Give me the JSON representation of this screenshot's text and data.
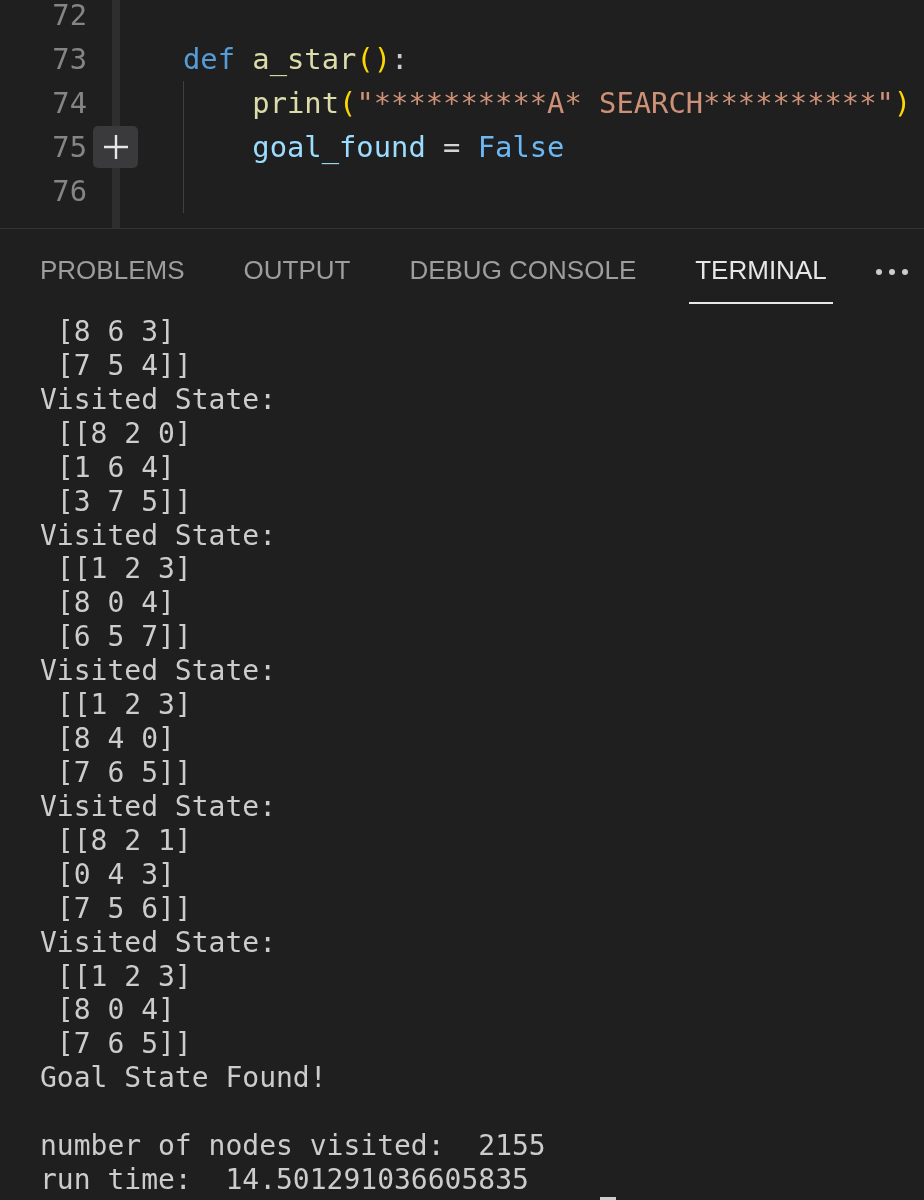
{
  "editor": {
    "lines": [
      {
        "number": "72",
        "add_button": false
      },
      {
        "number": "73",
        "add_button": false,
        "tokens": [
          {
            "kind": "keyword",
            "text": "def "
          },
          {
            "kind": "function",
            "text": "a_star"
          },
          {
            "kind": "bracket",
            "text": "()"
          },
          {
            "kind": "punctuation",
            "text": ":"
          }
        ],
        "children": [
          {
            "number": "74",
            "add_button": false,
            "tokens": [
              {
                "kind": "function",
                "text": "print"
              },
              {
                "kind": "bracket",
                "text": "("
              },
              {
                "kind": "string",
                "text": "\"**********A* SEARCH**********\""
              },
              {
                "kind": "bracket",
                "text": ")"
              }
            ]
          },
          {
            "number": "75",
            "add_button": true,
            "tokens": [
              {
                "kind": "variable",
                "text": "goal_found"
              },
              {
                "kind": "operator",
                "text": " = "
              },
              {
                "kind": "constant",
                "text": "False"
              }
            ]
          },
          {
            "number": "76",
            "add_button": false
          }
        ]
      }
    ]
  },
  "panel": {
    "tabs": [
      {
        "label": "PROBLEMS",
        "selected": false
      },
      {
        "label": "OUTPUT",
        "selected": false
      },
      {
        "label": "DEBUG CONSOLE",
        "selected": false
      },
      {
        "label": "TERMINAL",
        "selected": true
      }
    ],
    "terminal": {
      "lines": [
        " [8 6 3]",
        " [7 5 4]]",
        "Visited State:",
        " [[8 2 0]",
        " [1 6 4]",
        " [3 7 5]]",
        "Visited State:",
        " [[1 2 3]",
        " [8 0 4]",
        " [6 5 7]]",
        "Visited State:",
        " [[1 2 3]",
        " [8 4 0]",
        " [7 6 5]]",
        "Visited State:",
        " [[8 2 1]",
        " [0 4 3]",
        " [7 5 6]]",
        "Visited State:",
        " [[1 2 3]",
        " [8 0 4]",
        " [7 6 5]]",
        "Goal State Found!"
      ],
      "summary": [
        "number of nodes visited:  2155",
        "run time:  14.501291036605835"
      ]
    }
  }
}
